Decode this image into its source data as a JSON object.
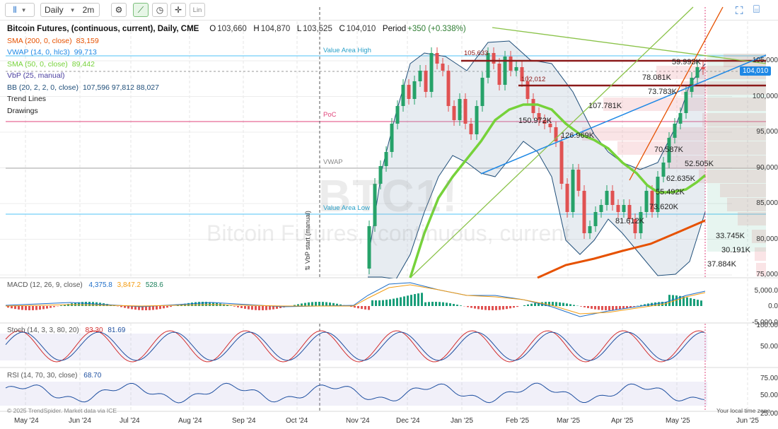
{
  "toolbar": {
    "interval": "Daily",
    "range": "2m",
    "scale": "Lin"
  },
  "legend": {
    "title": "Bitcoin Futures, (continuous, current), Daily, CME",
    "open_label": "O",
    "open": "103,660",
    "high_label": "H",
    "high": "104,870",
    "low_label": "L",
    "low": "103,525",
    "close_label": "C",
    "close": "104,010",
    "period_label": "Period",
    "period": "+350 (+0.338%)",
    "studies": [
      {
        "label": "SMA (200, 0, close)",
        "value": "83,159",
        "color": "#e65100"
      },
      {
        "label": "VWAP (14, 0, hlc3)",
        "value": "99,713",
        "color": "#1e88e5"
      },
      {
        "label": "SMA (50, 0, close)",
        "value": "89,442",
        "color": "#76d23a"
      },
      {
        "label": "VbP (25, manual)",
        "value": "",
        "color": "#4a3fa0"
      },
      {
        "label": "BB (20, 2, 2, 0, close)",
        "value": "107,596 97,812 88,027",
        "color": "#1f4e79"
      },
      {
        "label": "Trend Lines",
        "value": "",
        "color": "#222"
      },
      {
        "label": "Drawings",
        "value": "",
        "color": "#222"
      }
    ]
  },
  "annotations": {
    "value_area_high": "Value Area High",
    "poc": "PoC",
    "vwap": "VWAP",
    "value_area_low": "Value Area Low",
    "vbp_start": "⇅ VbP start (manual)",
    "level_high": "105,633",
    "level_mid": "102,012",
    "watermark_symbol": "BTC1!",
    "watermark_name": "Bitcoin Futures, (continuous, current"
  },
  "price_axis": [
    "105,000",
    "100,000",
    "95,000",
    "90,000",
    "85,000",
    "80,000",
    "75,000"
  ],
  "last_price": "104,010",
  "vbp_labels": [
    "59.993K",
    "78.081K",
    "73.783K",
    "107.781K",
    "150.972K",
    "126.969K",
    "70.587K",
    "52.505K",
    "62.635K",
    "55.492K",
    "73.620K",
    "81.612K",
    "33.745K",
    "30.191K",
    "37.884K"
  ],
  "macd": {
    "label": "MACD (12, 26, 9, close)",
    "v1": "4,375.8",
    "v2": "3,847.2",
    "v3": "528.6",
    "axis": [
      "5,000.0",
      "0.0",
      "-5,000.0"
    ]
  },
  "stoch": {
    "label": "Stoch (14, 3, 3, 80, 20)",
    "v1": "83.30",
    "v2": "81.69",
    "axis": [
      "100.00",
      "50.00"
    ]
  },
  "rsi": {
    "label": "RSI (14, 70, 30, close)",
    "v1": "68.70",
    "axis": [
      "75.00",
      "50.00",
      "25.00"
    ]
  },
  "copyright": "© 2025 TrendSpider. Market data via ICE",
  "local_time": "Your local time zone",
  "x_axis": [
    "May '24",
    "Jun '24",
    "Jul '24",
    "Aug '24",
    "Sep '24",
    "Oct '24",
    "Nov '24",
    "Dec '24",
    "Jan '25",
    "Feb '25",
    "Mar '25",
    "Apr '25",
    "May '25",
    "Jun '25"
  ]
}
